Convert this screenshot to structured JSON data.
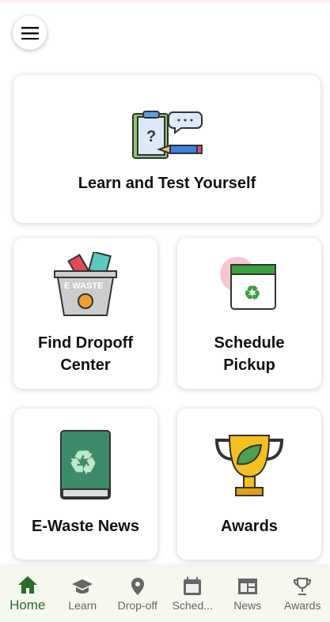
{
  "cards": {
    "learn": "Learn and Test Yourself",
    "dropoff": "Find Dropoff Center",
    "pickup": "Schedule Pickup",
    "news": "E-Waste News",
    "awards": "Awards"
  },
  "ewaste_logo_text": "E WASTE",
  "nav": [
    {
      "label": "Home",
      "icon": "home-icon"
    },
    {
      "label": "Learn",
      "icon": "graduation-cap-icon"
    },
    {
      "label": "Drop-off",
      "icon": "map-pin-icon"
    },
    {
      "label": "Sched...",
      "icon": "calendar-icon"
    },
    {
      "label": "News",
      "icon": "newspaper-icon"
    },
    {
      "label": "Awards",
      "icon": "trophy-icon"
    }
  ],
  "colors": {
    "active": "#2e6b30",
    "inactive": "#666666",
    "nav_bg": "#f4f8ef"
  }
}
